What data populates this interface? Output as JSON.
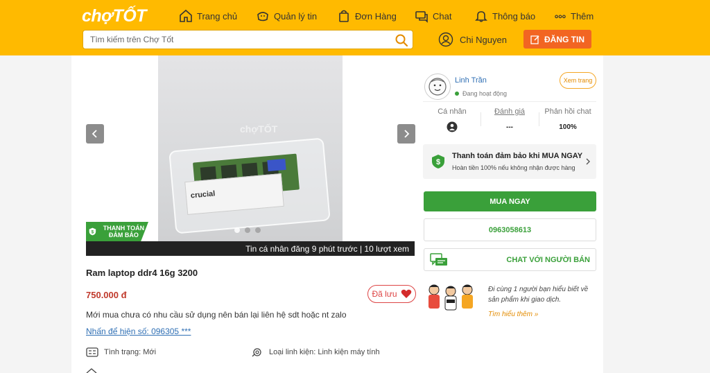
{
  "header": {
    "logo": "chợTỐT",
    "nav": [
      {
        "label": "Trang chủ",
        "icon": "home-icon"
      },
      {
        "label": "Quản lý tin",
        "icon": "manage-posts-icon"
      },
      {
        "label": "Đơn Hàng",
        "icon": "shopping-bag-icon"
      },
      {
        "label": "Chat",
        "icon": "chat-icon"
      },
      {
        "label": "Thông báo",
        "icon": "bell-icon"
      },
      {
        "label": "Thêm",
        "icon": "more-dots-icon"
      }
    ],
    "search_placeholder": "Tìm kiếm trên Chợ Tốt",
    "user_name": "Chi Nguyen",
    "post_button": "ĐĂNG TIN",
    "accent_color": "#ffba00",
    "post_button_color": "#f26522"
  },
  "gallery": {
    "watermark": "chợTỐT",
    "ram_brand": "crucial",
    "badge": "THANH TOÁN ĐẢM BẢO",
    "caption": "Tin cá nhân đăng 9 phút trước | 10 lượt xem",
    "current_slide": 1,
    "total_slides": 3
  },
  "product": {
    "title": "Ram laptop ddr4 16g 3200",
    "price": "750.000 đ",
    "saved_label": "Đã lưu",
    "description": "Mới mua chưa có nhu cầu sử dụng nên bán lại liên hệ sdt hoặc nt zalo",
    "phone_link": "Nhấn để hiện số: 096305 ***",
    "condition": "Tình trạng: Mới",
    "category": "Loại linh kiện: Linh kiện máy tính",
    "price_color": "#c0392b"
  },
  "seller": {
    "name": "Linh Trần",
    "status": "Đang hoạt động",
    "view_button": "Xem trang",
    "stats": [
      {
        "label": "Cá nhân",
        "value": ""
      },
      {
        "label": "Đánh giá",
        "value": "---"
      },
      {
        "label": "Phản hồi chat",
        "value": "100%"
      }
    ]
  },
  "payment": {
    "title": "Thanh toán đảm bảo khi MUA NGAY",
    "subtitle": "Hoàn tiền 100% nếu không nhận được hàng"
  },
  "actions": {
    "buy_now": "MUA NGAY",
    "phone": "0963058613",
    "chat": "CHAT VỚI NGƯỜI BÁN",
    "green_color": "#3aa03a"
  },
  "promo": {
    "text": "Đi cùng 1 người bạn hiểu biết về sản phẩm khi giao dịch.",
    "link": "Tìm hiểu thêm »"
  }
}
